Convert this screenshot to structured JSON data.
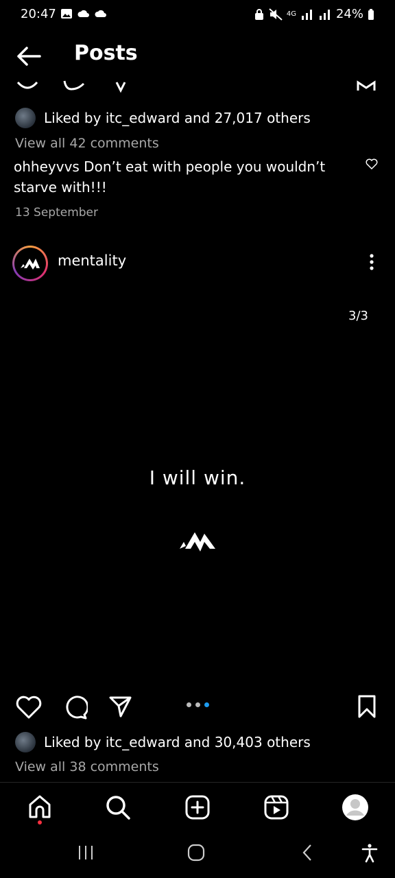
{
  "status_bar": {
    "time": "20:47",
    "battery": "24%",
    "network": "4G"
  },
  "header": {
    "title": "Posts"
  },
  "previous_post": {
    "liked_by": "Liked by itc_edward and 27,017 others",
    "view_comments": "View all 42 comments",
    "caption": "ohheyvvs Don’t eat with people you wouldn’t starve with!!!",
    "date": "13 September"
  },
  "current_post": {
    "username": "mentality",
    "slide_counter": "3/3",
    "image_text": "I will win.",
    "liked_by": "Liked by itc_edward and 30,403 others",
    "view_comments": "View all 38 comments",
    "carousel": {
      "total": 3,
      "active": 3
    }
  },
  "bottom_nav": [
    "home-icon",
    "search-icon",
    "create-icon",
    "reels-icon",
    "profile-icon"
  ],
  "colors": {
    "background": "#000000",
    "muted_text": "#a8a8a8",
    "active_dot": "#1d9bf0",
    "notification_dot": "#ff3040"
  }
}
